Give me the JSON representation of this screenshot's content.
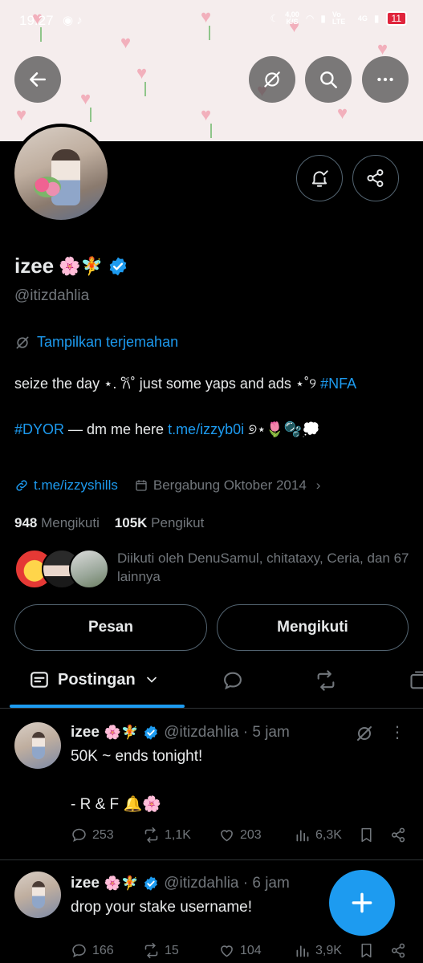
{
  "status_bar": {
    "time": "19.27",
    "net_speed": "4,00",
    "net_unit": "K/S",
    "network": "Vo LTE",
    "signal": "4G",
    "battery": "11"
  },
  "profile": {
    "name": "izee",
    "name_emoji": "🌸🧚",
    "handle": "@itizdahlia",
    "translate_label": "Tampilkan terjemahan",
    "bio_line1_text": "seize the day ⋆. 𐙚˚ just some yaps and ads ⋆˚୨",
    "bio_line1_tag": "#NFA",
    "bio_line2_tag": "#DYOR",
    "bio_line2_text": " — dm me here ",
    "bio_line2_link": "t.me/izzyb0i",
    "bio_line2_emoji": " ୭⋆🌷🫧💭",
    "website": "t.me/izzyshills",
    "joined": "Bergabung Oktober 2014",
    "following_count": "948",
    "following_label": "Mengikuti",
    "followers_count": "105K",
    "followers_label": "Pengikut",
    "followed_by": "Diikuti oleh DenuSamul, chitataxy, Ceria, dan 67 lainnya"
  },
  "buttons": {
    "message": "Pesan",
    "following": "Mengikuti"
  },
  "tabs": {
    "active_label": "Postingan"
  },
  "posts": [
    {
      "name": "izee",
      "emoji": "🌸🧚",
      "meta": "@itizdahlia · 5 jam",
      "text": "50K ~ ends tonight!\n\n- R & F 🔔🌸",
      "replies": "253",
      "reposts": "1,1K",
      "likes": "203",
      "views": "6,3K"
    },
    {
      "name": "izee",
      "emoji": "🌸🧚",
      "meta": "@itizdahlia · 6 jam",
      "text": "drop your stake username!",
      "replies": "166",
      "reposts": "15",
      "likes": "104",
      "views": "3,9K"
    }
  ],
  "colors": {
    "accent": "#1d9bf0",
    "muted": "#71767b",
    "text": "#e7e9ea",
    "border": "#2f3336"
  }
}
